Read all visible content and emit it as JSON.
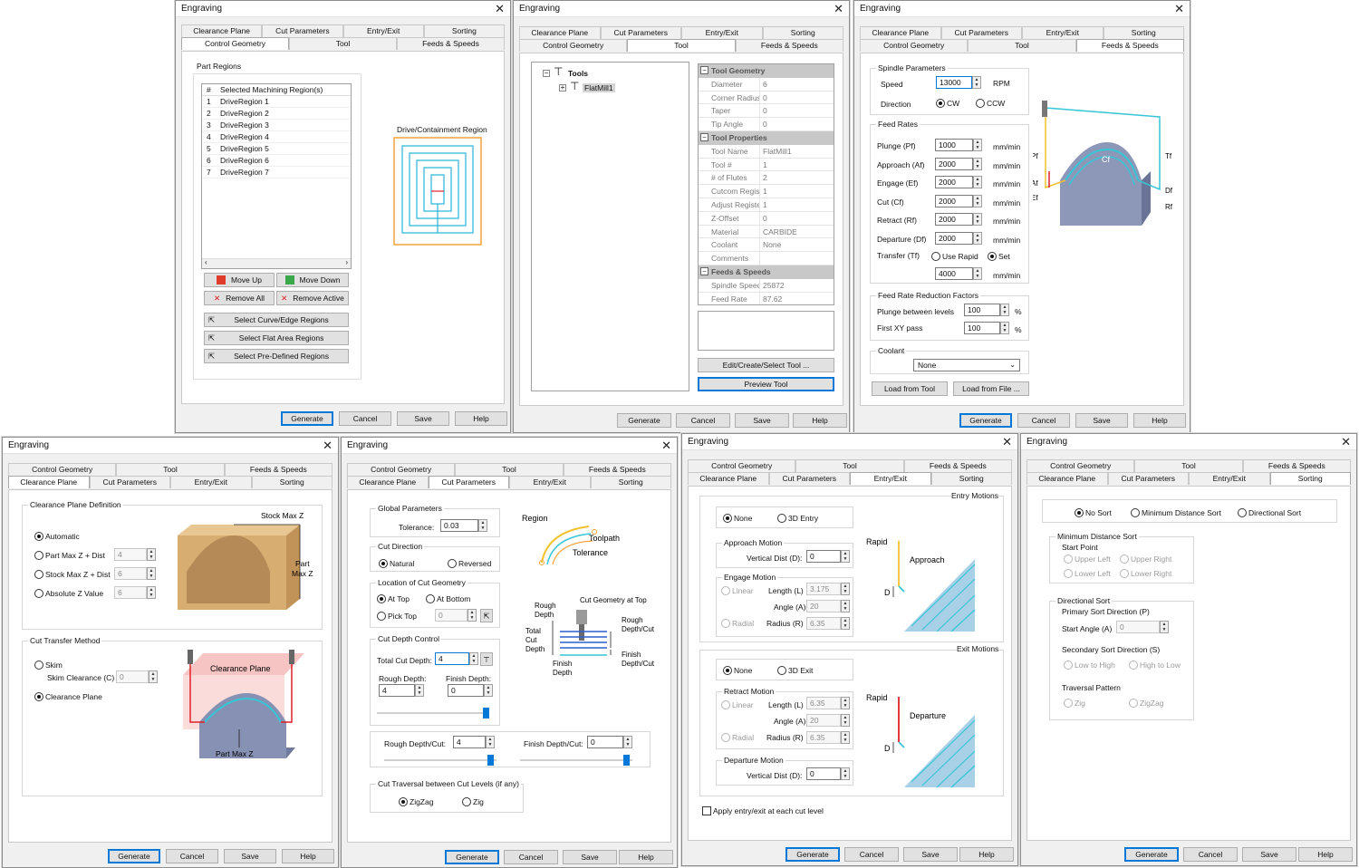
{
  "common": {
    "title": "Engraving",
    "close": "✕",
    "generate": "Generate",
    "cancel": "Cancel",
    "save": "Save",
    "help": "Help"
  },
  "tabs": {
    "clearance_plane": "Clearance Plane",
    "cut_parameters": "Cut Parameters",
    "entry_exit": "Entry/Exit",
    "sorting": "Sorting",
    "control_geometry": "Control Geometry",
    "tool": "Tool",
    "feeds_speeds": "Feeds & Speeds"
  },
  "control_geometry": {
    "group": "Part Regions",
    "header_num": "#",
    "header_name": "Selected Machining Region(s)",
    "regions": [
      {
        "n": "1",
        "name": "DriveRegion 1"
      },
      {
        "n": "2",
        "name": "DriveRegion 2"
      },
      {
        "n": "3",
        "name": "DriveRegion 3"
      },
      {
        "n": "4",
        "name": "DriveRegion 4"
      },
      {
        "n": "5",
        "name": "DriveRegion 5"
      },
      {
        "n": "6",
        "name": "DriveRegion 6"
      },
      {
        "n": "7",
        "name": "DriveRegion 7"
      }
    ],
    "move_up": "Move Up",
    "move_down": "Move Down",
    "remove_all": "Remove All",
    "remove_active": "Remove Active",
    "select_curve": "Select Curve/Edge Regions",
    "select_flat": "Select Flat Area Regions",
    "select_predefined": "Select Pre-Defined Regions",
    "preview_label": "Drive/Containment Region"
  },
  "tool": {
    "tree_root": "Tools",
    "tree_item": "FlatMill1",
    "cat_geometry": "Tool Geometry",
    "cat_properties": "Tool Properties",
    "cat_feeds": "Feeds & Speeds",
    "geometry": [
      {
        "k": "Diameter",
        "v": "6"
      },
      {
        "k": "Corner Radius",
        "v": "0"
      },
      {
        "k": "Taper",
        "v": "0"
      },
      {
        "k": "Tip Angle",
        "v": "0"
      }
    ],
    "properties": [
      {
        "k": "Tool Name",
        "v": "FlatMill1"
      },
      {
        "k": "Tool #",
        "v": "1"
      },
      {
        "k": "# of Flutes",
        "v": "2"
      },
      {
        "k": "Cutcom Registe",
        "v": "1"
      },
      {
        "k": "Adjust Register",
        "v": "1"
      },
      {
        "k": "Z-Offset",
        "v": "0"
      },
      {
        "k": "Material",
        "v": "CARBIDE"
      },
      {
        "k": "Coolant",
        "v": "None"
      },
      {
        "k": "Comments",
        "v": ""
      }
    ],
    "feeds": [
      {
        "k": "Spindle Speed",
        "v": "25872"
      },
      {
        "k": "Feed Rate",
        "v": "87.62"
      }
    ],
    "edit_button": "Edit/Create/Select Tool ...",
    "preview_button": "Preview Tool"
  },
  "feeds_speeds": {
    "spindle_group": "Spindle Parameters",
    "speed_label": "Speed",
    "speed_value": "13000",
    "rpm": "RPM",
    "direction_label": "Direction",
    "cw": "CW",
    "ccw": "CCW",
    "feed_group": "Feed Rates",
    "rates": [
      {
        "label": "Plunge (Pf)",
        "value": "1000",
        "unit": "mm/min"
      },
      {
        "label": "Approach (Af)",
        "value": "2000",
        "unit": "mm/min"
      },
      {
        "label": "Engage (Ef)",
        "value": "2000",
        "unit": "mm/min"
      },
      {
        "label": "Cut (Cf)",
        "value": "2000",
        "unit": "mm/min"
      },
      {
        "label": "Retract (Rf)",
        "value": "2000",
        "unit": "mm/min"
      },
      {
        "label": "Departure (Df)",
        "value": "2000",
        "unit": "mm/min"
      }
    ],
    "transfer_label": "Transfer (Tf)",
    "use_rapid": "Use Rapid",
    "set": "Set",
    "transfer_value": "4000",
    "transfer_unit": "mm/min",
    "reduction_group": "Feed Rate Reduction Factors",
    "plunge_between": "Plunge between levels",
    "plunge_between_value": "100",
    "first_xy": "First XY pass",
    "first_xy_value": "100",
    "pct": "%",
    "coolant_group": "Coolant",
    "coolant_value": "None",
    "load_tool": "Load from Tool",
    "load_file": "Load from File ...",
    "img_labels": {
      "pf": "Pf",
      "af": "Af",
      "ef": "Ef",
      "cf": "Cf",
      "tf": "Tf",
      "df": "Df",
      "rf": "Rf"
    }
  },
  "clearance": {
    "group": "Clearance Plane Definition",
    "automatic": "Automatic",
    "part_max": "Part Max Z + Dist",
    "part_max_value": "4",
    "stock_max": "Stock Max Z + Dist",
    "stock_max_value": "6",
    "absolute": "Absolute Z Value",
    "absolute_value": "6",
    "img_stock": "Stock Max Z",
    "img_part1": "Part",
    "img_part2": "Max Z",
    "transfer_group": "Cut Transfer Method",
    "skim": "Skim",
    "skim_clearance": "Skim Clearance (C)",
    "skim_value": "0",
    "clearance_plane": "Clearance Plane",
    "img_clearance": "Clearance Plane",
    "img_partmax": "Part Max Z"
  },
  "cut_params": {
    "global_group": "Global Parameters",
    "tolerance_label": "Tolerance:",
    "tolerance_value": "0.03",
    "direction_group": "Cut Direction",
    "natural": "Natural",
    "reversed": "Reversed",
    "location_group": "Location of Cut Geometry",
    "at_top": "At Top",
    "at_bottom": "At Bottom",
    "pick_top": "Pick Top",
    "pick_value": "0",
    "depth_group": "Cut Depth Control",
    "total_depth_label": "Total Cut Depth:",
    "total_depth_value": "4",
    "rough_depth_label": "Rough Depth:",
    "rough_depth_value": "4",
    "finish_depth_label": "Finish Depth:",
    "finish_depth_value": "0",
    "rough_cut_label": "Rough Depth/Cut:",
    "rough_cut_value": "4",
    "finish_cut_label": "Finish Depth/Cut:",
    "finish_cut_value": "0",
    "traversal_group": "Cut Traversal between Cut Levels (if any)",
    "zigzag": "ZigZag",
    "zig": "Zig",
    "img_region": "Region",
    "img_toolpath": "Toolpath",
    "img_tolerance": "Tolerance",
    "img_cutgeom": "Cut Geometry at Top",
    "img_rough_depth1": "Rough",
    "img_rough_depth2": "Depth",
    "img_total1": "Total",
    "img_total2": "Cut",
    "img_total3": "Depth",
    "img_finish1": "Finish",
    "img_finish2": "Depth",
    "img_rdc1": "Rough",
    "img_rdc2": "Depth/Cut",
    "img_fdc1": "Finish",
    "img_fdc2": "Depth/Cut"
  },
  "entry_exit": {
    "entry_title": "Entry Motions",
    "none": "None",
    "entry_3d": "3D Entry",
    "approach_group": "Approach Motion",
    "vertical_dist": "Vertical Dist (D):",
    "approach_value": "0",
    "engage_group": "Engage Motion",
    "linear": "Linear",
    "length": "Length (L)",
    "engage_length": "3.175",
    "angle": "Angle (A)",
    "engage_angle": "20",
    "radial": "Radial",
    "radius": "Radius (R)",
    "engage_radius": "6.35",
    "exit_title": "Exit Motions",
    "exit_3d": "3D Exit",
    "retract_group": "Retract Motion",
    "retract_length": "6.35",
    "retract_angle": "20",
    "retract_radius": "6.35",
    "departure_group": "Departure Motion",
    "departure_value": "0",
    "apply_each": "Apply entry/exit at each cut level",
    "img_rapid": "Rapid",
    "img_approach": "Approach",
    "img_departure": "Departure",
    "img_d": "D"
  },
  "sorting": {
    "no_sort": "No Sort",
    "min_dist": "Minimum Distance Sort",
    "directional": "Directional Sort",
    "min_group": "Minimum Distance Sort",
    "start_point": "Start Point",
    "upper_left": "Upper Left",
    "upper_right": "Upper Right",
    "lower_left": "Lower Left",
    "lower_right": "Lower Right",
    "dir_group": "Directional Sort",
    "primary": "Primary Sort Direction (P)",
    "start_angle": "Start Angle (A)",
    "start_angle_value": "0",
    "secondary": "Secondary Sort Direction (S)",
    "low_high": "Low to High",
    "high_low": "High to Low",
    "traversal": "Traversal Pattern",
    "zig": "Zig",
    "zigzag": "ZigZag"
  },
  "colors": {
    "accent": "#0078d7",
    "toolpath": "#36c6d6",
    "rapid": "#e0202a",
    "approach": "#f2c22e",
    "part": "#7b86a8"
  }
}
